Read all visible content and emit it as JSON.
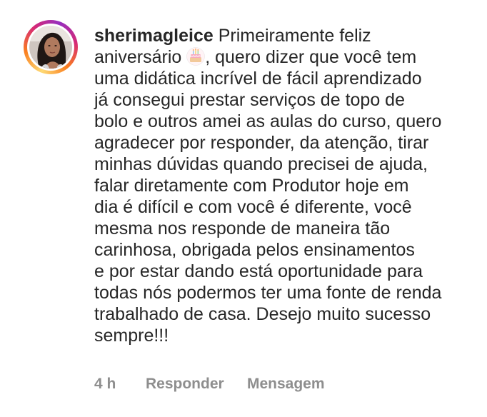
{
  "comment": {
    "username": "sherimagleice",
    "text_part1": "Primeiramente feliz\naniversário ",
    "emoji_icon": "birthday-cake-icon",
    "text_part2": ", quero dizer que você tem\numa didática incrível de fácil aprendizado\njá consegui prestar serviços de topo de\nbolo e outros amei as aulas do curso, quero\nagradecer por responder,  da atenção, tirar\nminhas dúvidas quando precisei de ajuda,\nfalar diretamente com Produtor hoje em\ndia é difícil e com você é diferente, você\nmesma nos responde de maneira tão\ncarinhosa, obrigada pelos ensinamentos\ne por estar dando está oportunidade para\ntodas nós podermos ter uma fonte de renda\ntrabalhado de casa. Desejo muito sucesso\nsempre!!!",
    "time": "4 h",
    "reply_label": "Responder",
    "message_label": "Mensagem"
  },
  "colors": {
    "text": "#262626",
    "meta": "#8e8e8e",
    "ring_start": "#feda75",
    "ring_end": "#d62976"
  }
}
